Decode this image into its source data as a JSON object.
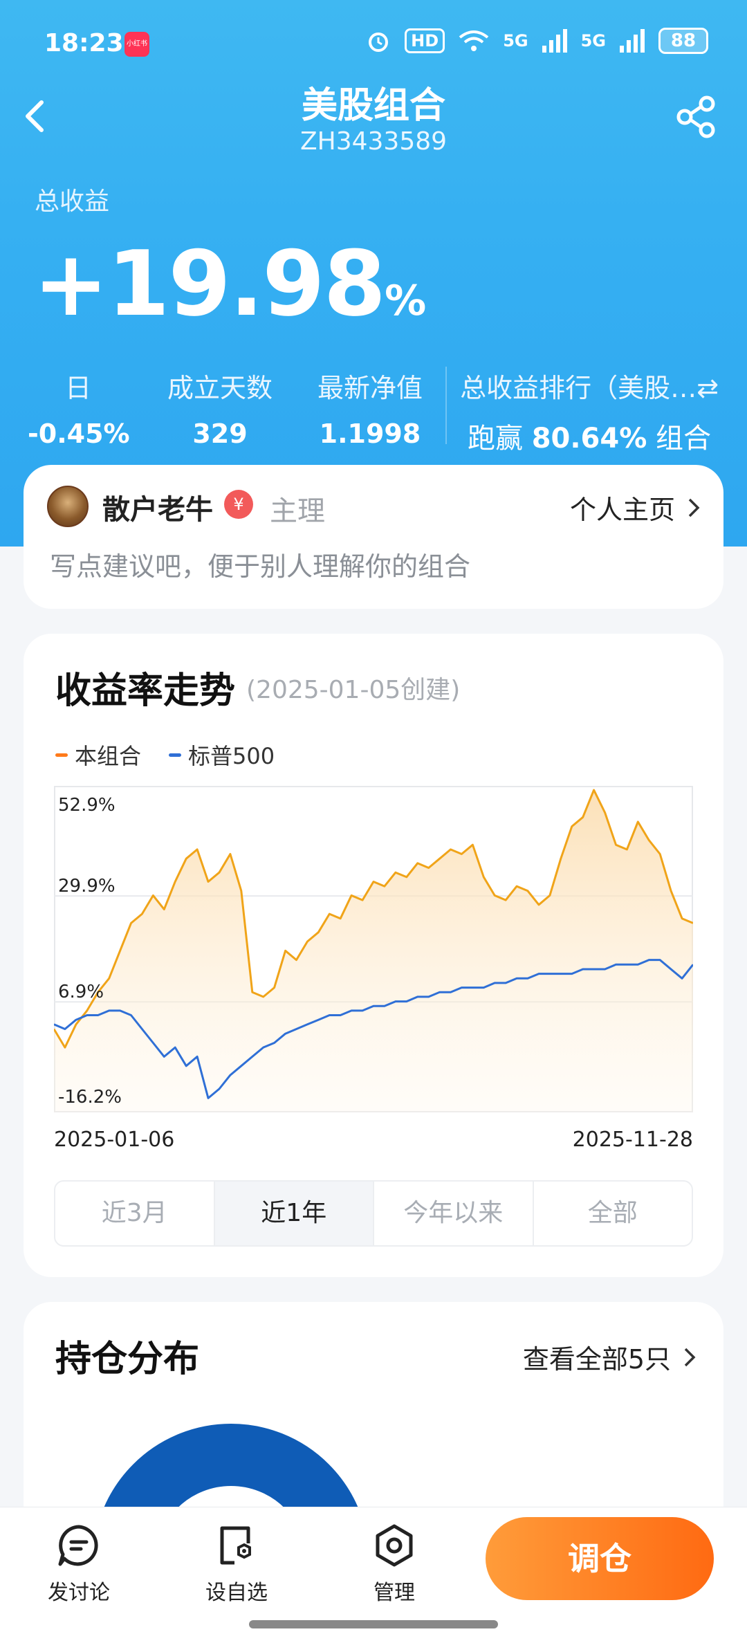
{
  "status_bar": {
    "time": "18:23",
    "app_badge": "小红书",
    "hd": "HD",
    "net1": "5G",
    "net2": "5G",
    "battery": "88"
  },
  "nav": {
    "title": "美股组合",
    "subtitle": "ZH3433589"
  },
  "summary": {
    "total_label": "总收益",
    "total_value": "+19.98",
    "total_unit": "%",
    "day_label": "日",
    "day_value": "-0.45%",
    "days_label": "成立天数",
    "days_value": "329",
    "nav_label": "最新净值",
    "nav_value": "1.1998",
    "rank_label": "总收益排行（美股…⇄",
    "rank_prefix": "跑赢",
    "rank_value": "80.64%",
    "rank_suffix": "组合"
  },
  "manager": {
    "name": "散户老牛",
    "badge": "¥",
    "role": "主理",
    "home_link": "个人主页",
    "description": "写点建议吧，便于别人理解你的组合"
  },
  "chart_card": {
    "title": "收益率走势",
    "subtitle": "(2025-01-05创建)",
    "tabs": [
      "近3月",
      "近1年",
      "今年以来",
      "全部"
    ],
    "active_tab": 1
  },
  "chart_data": {
    "type": "line",
    "x_start": "2025-01-06",
    "x_end": "2025-11-28",
    "ylim": [
      -16.2,
      52.9
    ],
    "y_ticks": [
      "52.9%",
      "29.9%",
      "6.9%",
      "-16.2%"
    ],
    "y_tick_values": [
      52.9,
      29.9,
      6.9,
      -16.2
    ],
    "legend_position": "top-left",
    "grid": true,
    "series": [
      {
        "name": "本组合",
        "color": "#f0a419",
        "values": [
          1.0,
          -3.0,
          2.0,
          5.0,
          9.0,
          12.0,
          18.0,
          24.0,
          26.0,
          30.0,
          27.0,
          33.0,
          38.0,
          40.0,
          33.0,
          35.0,
          39.0,
          31.0,
          9.0,
          8.0,
          10.0,
          18.0,
          16.0,
          20.0,
          22.0,
          26.0,
          25.0,
          30.0,
          29.0,
          33.0,
          32.0,
          35.0,
          34.0,
          37.0,
          36.0,
          38.0,
          40.0,
          39.0,
          41.0,
          34.0,
          30.0,
          29.0,
          32.0,
          31.0,
          28.0,
          30.0,
          38.0,
          45.0,
          47.0,
          52.9,
          48.0,
          41.0,
          40.0,
          46.0,
          42.0,
          39.0,
          31.0,
          25.0,
          24.0
        ]
      },
      {
        "name": "标普500",
        "color": "#2f6fd6",
        "values": [
          2.0,
          1.0,
          3.0,
          4.0,
          4.0,
          5.0,
          5.0,
          4.0,
          1.0,
          -2.0,
          -5.0,
          -3.0,
          -7.0,
          -5.0,
          -14.0,
          -12.0,
          -9.0,
          -7.0,
          -5.0,
          -3.0,
          -2.0,
          0.0,
          1.0,
          2.0,
          3.0,
          4.0,
          4.0,
          5.0,
          5.0,
          6.0,
          6.0,
          7.0,
          7.0,
          8.0,
          8.0,
          9.0,
          9.0,
          10.0,
          10.0,
          10.0,
          11.0,
          11.0,
          12.0,
          12.0,
          13.0,
          13.0,
          13.0,
          13.0,
          14.0,
          14.0,
          14.0,
          15.0,
          15.0,
          15.0,
          16.0,
          16.0,
          14.0,
          12.0,
          15.0
        ]
      }
    ]
  },
  "holdings": {
    "title": "持仓分布",
    "more": "查看全部5只"
  },
  "bottom_bar": {
    "discuss": "发讨论",
    "watch": "设自选",
    "manage": "管理",
    "adjust": "调仓"
  },
  "colors": {
    "accent_blue": "#36b0f2",
    "accent_orange": "#ff7a1a"
  }
}
